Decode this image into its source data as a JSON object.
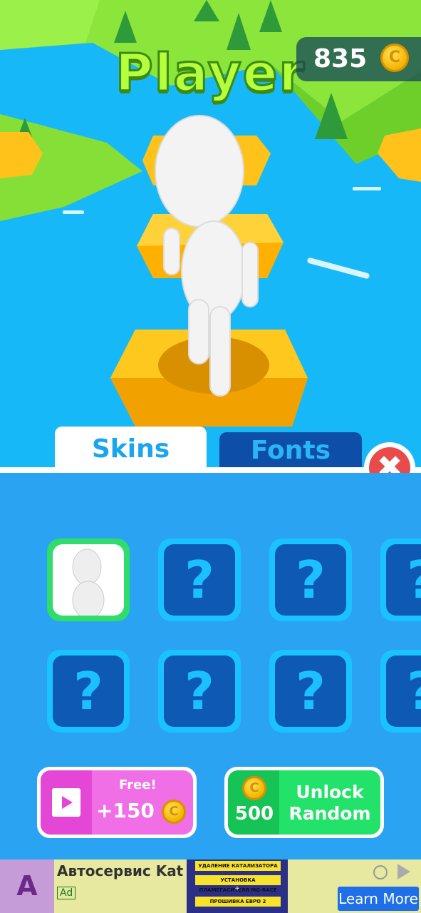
{
  "header": {
    "player_name": "Player",
    "coin_balance": "835",
    "coin_symbol": "C"
  },
  "tabs": [
    {
      "label": "Skins",
      "active": true
    },
    {
      "label": "Fonts",
      "active": false
    }
  ],
  "close_symbol": "✖",
  "skins_grid": {
    "locked_symbol": "?",
    "selected_index": 0
  },
  "actions": {
    "free": {
      "label": "Free!",
      "amount": "+150",
      "coin_symbol": "C"
    },
    "unlock": {
      "price": "500",
      "label_line1": "Unlock",
      "label_line2": "Random",
      "coin_symbol": "C"
    }
  },
  "ad": {
    "logo_letter": "A",
    "title": "Автосервис Kat",
    "badge": "Ad",
    "banner_lines": [
      "УДАЛЕНИЕ КАТАЛИЗАТОРА",
      "УСТАНОВКА ПЛАМЕГАСИТЕЛЯ MG-RACE",
      "+",
      "ПРОШИВКА ЕВРО 2"
    ],
    "cta": "Learn More"
  },
  "colors": {
    "water": "#17b8f7",
    "grass": "#8be53a",
    "platform": "#ffc21a",
    "panel": "#2aa3f2",
    "tab_active_text": "#1aa6ee",
    "close": "#e94a4a"
  }
}
